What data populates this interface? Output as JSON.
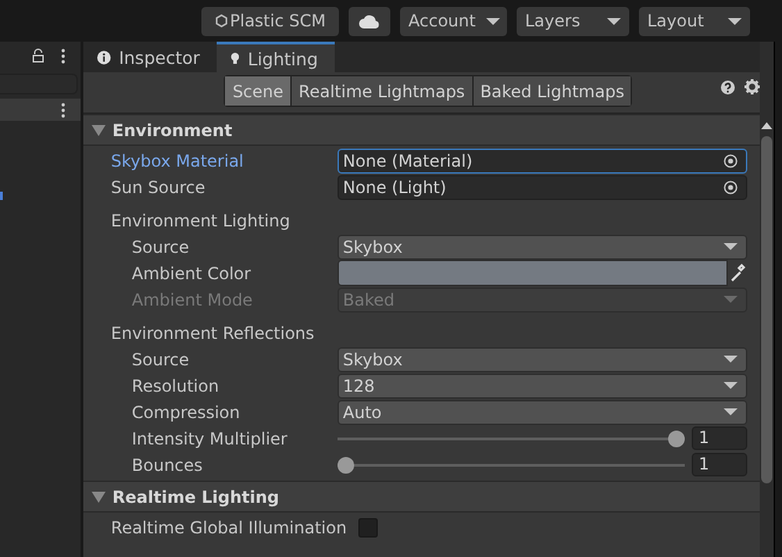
{
  "toolbar": {
    "plastic": "Plastic SCM",
    "menus": [
      {
        "label": "Account"
      },
      {
        "label": "Layers"
      },
      {
        "label": "Layout"
      }
    ]
  },
  "tabs": [
    {
      "label": "Inspector",
      "kind": "info",
      "selected": false
    },
    {
      "label": "Lighting",
      "kind": "bulb",
      "selected": true
    }
  ],
  "subtabs": [
    {
      "label": "Scene",
      "selected": true
    },
    {
      "label": "Realtime Lightmaps",
      "selected": false
    },
    {
      "label": "Baked Lightmaps",
      "selected": false
    }
  ],
  "sections": [
    {
      "title": "Environment",
      "expanded": true,
      "rows": [
        {
          "kind": "object",
          "label": "Skybox Material",
          "value": "None (Material)",
          "focused": true
        },
        {
          "kind": "object",
          "label": "Sun Source",
          "value": "None (Light)",
          "focused": false
        },
        {
          "kind": "heading",
          "label": "Environment Lighting",
          "children": [
            {
              "kind": "dropdown",
              "label": "Source",
              "value": "Skybox",
              "disabled": false
            },
            {
              "kind": "color",
              "label": "Ambient Color",
              "color": "#747a82"
            },
            {
              "kind": "dropdown",
              "label": "Ambient Mode",
              "value": "Baked",
              "disabled": true
            }
          ]
        },
        {
          "kind": "heading",
          "label": "Environment Reflections",
          "children": [
            {
              "kind": "dropdown",
              "label": "Source",
              "value": "Skybox",
              "disabled": false
            },
            {
              "kind": "dropdown",
              "label": "Resolution",
              "value": "128",
              "disabled": false
            },
            {
              "kind": "dropdown",
              "label": "Compression",
              "value": "Auto",
              "disabled": false
            },
            {
              "kind": "slider",
              "label": "Intensity Multiplier",
              "level": 1,
              "value": "1"
            },
            {
              "kind": "slider",
              "label": "Bounces",
              "level": 0,
              "value": "1"
            }
          ]
        }
      ]
    },
    {
      "title": "Realtime Lighting",
      "expanded": true,
      "rows": [
        {
          "kind": "checkbox",
          "label": "Realtime Global Illumination",
          "checked": false
        }
      ]
    }
  ]
}
